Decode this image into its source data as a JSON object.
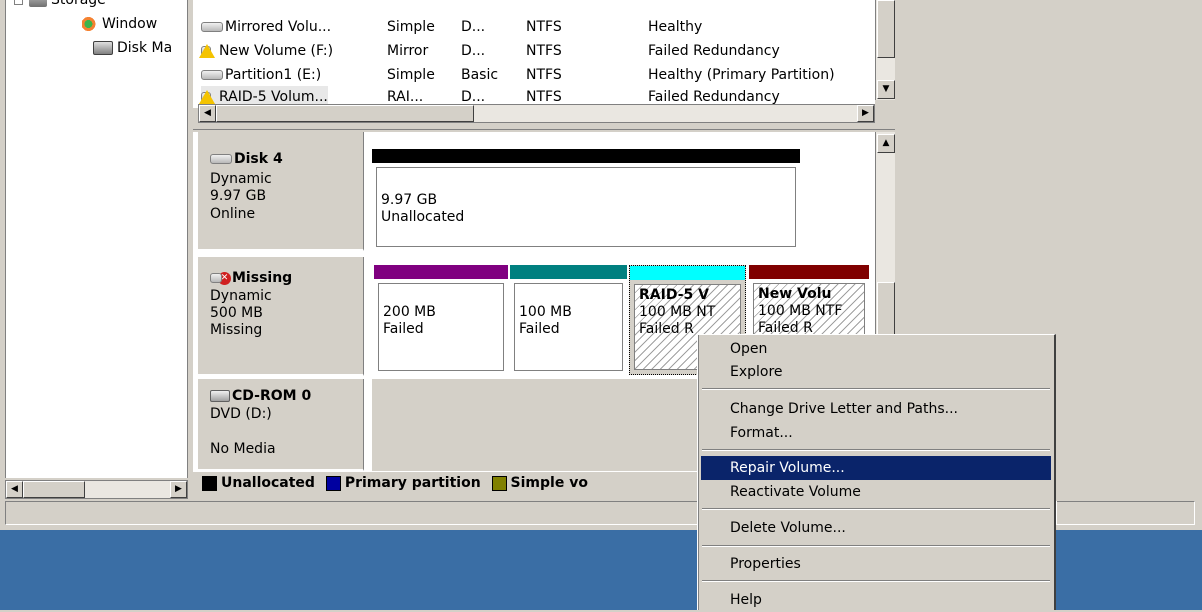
{
  "tree": {
    "items": [
      {
        "label": "Storage"
      },
      {
        "label": "Window"
      },
      {
        "label": "Disk Ma"
      }
    ]
  },
  "volumes": [
    {
      "name": "Mirrored Volu...",
      "layout": "Simple",
      "type": "D...",
      "fs": "NTFS",
      "status": "Healthy"
    },
    {
      "name": "New Volume (F:)",
      "layout": "Mirror",
      "type": "D...",
      "fs": "NTFS",
      "status": "Failed Redundancy"
    },
    {
      "name": "Partition1 (E:)",
      "layout": "Simple",
      "type": "Basic",
      "fs": "NTFS",
      "status": "Healthy (Primary Partition)"
    },
    {
      "name": "RAID-5 Volum...",
      "layout": "RAI...",
      "type": "D...",
      "fs": "NTFS",
      "status": "Failed Redundancy"
    }
  ],
  "disks": [
    {
      "name": "Disk 4",
      "type": "Dynamic",
      "size": "9.97 GB",
      "state": "Online",
      "partitions": [
        {
          "size": "9.97 GB",
          "status": "Unallocated",
          "color": "#000000"
        }
      ]
    },
    {
      "name": "Missing",
      "type": "Dynamic",
      "size": "500 MB",
      "state": "Missing",
      "partitions": [
        {
          "size": "200 MB",
          "status": "Failed",
          "color": "#800080"
        },
        {
          "size": "100 MB",
          "status": "Failed",
          "color": "#008080"
        },
        {
          "title": "RAID-5 V",
          "size": "100 MB NT",
          "status": "Failed R",
          "color": "#00ffff"
        },
        {
          "title": "New Volu",
          "size": "100 MB NTF",
          "status": "Failed R",
          "color": "#800000"
        }
      ]
    },
    {
      "name": "CD-ROM 0",
      "type": "DVD (D:)",
      "state": "No Media"
    }
  ],
  "legend": [
    {
      "label": "Unallocated",
      "color": "#000000"
    },
    {
      "label": "Primary partition",
      "color": "#0000a0"
    },
    {
      "label": "Simple vo",
      "color": "#808000"
    }
  ],
  "context_menu": {
    "items": [
      {
        "label": "Open"
      },
      {
        "label": "Explore"
      },
      {
        "label": "Change Drive Letter and Paths..."
      },
      {
        "label": "Format..."
      },
      {
        "label": "Repair Volume..."
      },
      {
        "label": "Reactivate Volume"
      },
      {
        "label": "Delete Volume..."
      },
      {
        "label": "Properties"
      },
      {
        "label": "Help"
      }
    ],
    "highlighted": "Repair Volume..."
  },
  "colors": {
    "menu_highlight": "#0a246a",
    "desktop": "#3a6ea5",
    "face": "#d4d0c8"
  }
}
